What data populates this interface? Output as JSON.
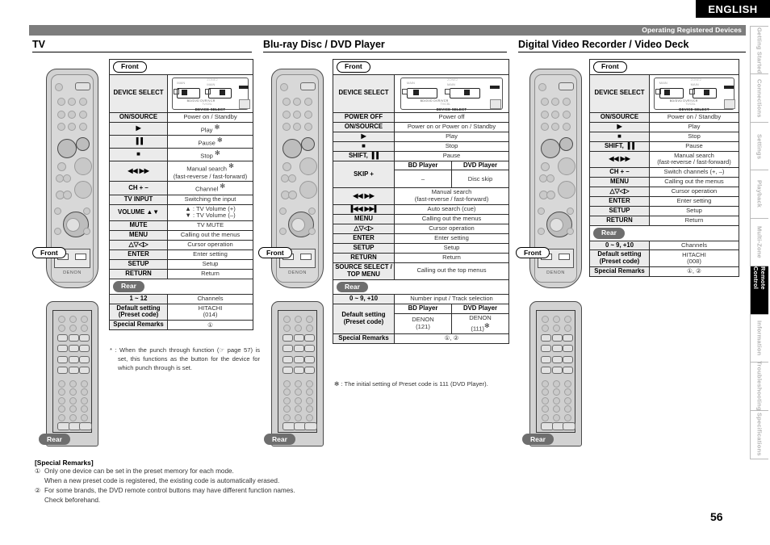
{
  "header": {
    "language_tab": "ENGLISH",
    "section_label": "Operating Registered Devices"
  },
  "page_number": "56",
  "sidebar": {
    "tabs": [
      {
        "label": "Getting Started",
        "active": false
      },
      {
        "label": "Connections",
        "active": false
      },
      {
        "label": "Settings",
        "active": false
      },
      {
        "label": "Playback",
        "active": false
      },
      {
        "label": "Multi-Zone",
        "active": false
      },
      {
        "label": "Remote Control",
        "active": true
      },
      {
        "label": "Information",
        "active": false
      },
      {
        "label": "Troubleshooting",
        "active": false
      },
      {
        "label": "Specifications",
        "active": false
      }
    ]
  },
  "columns": {
    "tv": {
      "title": "TV",
      "front_badge": "Front",
      "rear_badge": "Rear",
      "remote_front_badge": "Front",
      "remote_rear_badge": "Rear",
      "device_select_label": "DEVICE SELECT",
      "device_select_caption": "DEVICE SELECT",
      "rows": [
        {
          "key": "ON/SOURCE",
          "val": "Power on / Standby"
        },
        {
          "key": "▶",
          "val": "Play",
          "star": true
        },
        {
          "key": "▐▐",
          "val": "Pause",
          "star": true
        },
        {
          "key": "■",
          "val": "Stop",
          "star": true
        },
        {
          "key": "◀◀  ▶▶",
          "val": "Manual search",
          "val2": "(fast-reverse / fast-forward)",
          "star": true
        },
        {
          "key": "CH + –",
          "val": "Channel",
          "star": true
        },
        {
          "key": "TV INPUT",
          "val": "Switching the input"
        },
        {
          "key": "VOLUME ▲▼",
          "val": "▲ : TV Volume (+)",
          "val2": "▼ : TV Volume (–)"
        },
        {
          "key": "MUTE",
          "val": "TV MUTE"
        },
        {
          "key": "MENU",
          "val": "Calling out the menus"
        },
        {
          "key": "△▽◁▷",
          "val": "Cursor operation"
        },
        {
          "key": "ENTER",
          "val": "Enter setting"
        },
        {
          "key": "SETUP",
          "val": "Setup"
        },
        {
          "key": "RETURN",
          "val": "Return"
        }
      ],
      "rear_rows": [
        {
          "key": "1 ~ 12",
          "val": "Channels"
        },
        {
          "key": "Default setting",
          "key2": "(Preset code)",
          "val": "HITACHI",
          "val2": "(014)"
        },
        {
          "key": "Special Remarks",
          "val": "①"
        }
      ],
      "footnote": "* : When the punch through function (☞ page 57) is set, this functions as the button for the device for which punch through is set."
    },
    "bd": {
      "title": "Blu-ray Disc / DVD Player",
      "front_badge": "Front",
      "rear_badge": "Rear",
      "remote_front_badge": "Front",
      "remote_rear_badge": "Rear",
      "device_select_label": "DEVICE SELECT",
      "device_select_caption": "DEVICE SELECT",
      "rows": [
        {
          "key": "POWER OFF",
          "val": "Power off"
        },
        {
          "key": "ON/SOURCE",
          "val": "Power on or Power on / Standby"
        },
        {
          "key": "▶",
          "val": "Play"
        },
        {
          "key": "■",
          "val": "Stop"
        },
        {
          "key": "SHIFT, ▐▐",
          "val": "Pause"
        }
      ],
      "skip_block": {
        "col1_header": "BD Player",
        "col2_header": "DVD Player",
        "key": "SKIP +",
        "col1_val": "–",
        "col2_val": "Disc skip"
      },
      "rows2": [
        {
          "key": "◀◀  ▶▶",
          "val": "Manual search",
          "val2": "(fast-reverse / fast-forward)"
        },
        {
          "key": "▐◀◀  ▶▶▌",
          "val": "Auto search (cue)"
        },
        {
          "key": "MENU",
          "val": "Calling out the menus"
        },
        {
          "key": "△▽◁▷",
          "val": "Cursor operation"
        },
        {
          "key": "ENTER",
          "val": "Enter setting"
        },
        {
          "key": "SETUP",
          "val": "Setup"
        },
        {
          "key": "RETURN",
          "val": "Return"
        },
        {
          "key": "SOURCE SELECT /",
          "key2": "TOP MENU",
          "val": "Calling out the top menus"
        }
      ],
      "rear_rows": [
        {
          "key": "0 ~ 9, +10",
          "val": "Number input / Track selection"
        }
      ],
      "default_block": {
        "col1_header": "BD Player",
        "col2_header": "DVD Player",
        "key": "Default setting",
        "key2": "(Preset code)",
        "col1_val": "DENON",
        "col1_val2": "(121)",
        "col2_val": "DENON",
        "col2_val2": "(111)",
        "col2_star": true
      },
      "special_remarks": {
        "key": "Special Remarks",
        "val": "①, ②"
      },
      "footnote": "✻ : The initial setting of Preset code is 111 (DVD Player)."
    },
    "dvr": {
      "title": "Digital Video Recorder / Video Deck",
      "front_badge": "Front",
      "rear_badge": "Rear",
      "remote_front_badge": "Front",
      "remote_rear_badge": "Rear",
      "device_select_label": "DEVICE SELECT",
      "device_select_caption": "DEVICE SELECT",
      "rows": [
        {
          "key": "ON/SOURCE",
          "val": "Power on / Standby"
        },
        {
          "key": "▶",
          "val": "Play"
        },
        {
          "key": "■",
          "val": "Stop"
        },
        {
          "key": "SHIFT, ▐▐",
          "val": "Pause"
        },
        {
          "key": "◀◀  ▶▶",
          "val": "Manual search",
          "val2": "(fast-reverse / fast-forward)"
        },
        {
          "key": "CH + –",
          "val": "Switch channels (+, –)"
        },
        {
          "key": "MENU",
          "val": "Calling out the menus"
        },
        {
          "key": "△▽◁▷",
          "val": "Cursor operation"
        },
        {
          "key": "ENTER",
          "val": "Enter setting"
        },
        {
          "key": "SETUP",
          "val": "Setup"
        },
        {
          "key": "RETURN",
          "val": "Return"
        }
      ],
      "rear_rows": [
        {
          "key": "0 ~ 9, +10",
          "val": "Channels"
        },
        {
          "key": "Default setting",
          "key2": "(Preset code)",
          "val": "HITACHI",
          "val2": "(008)"
        },
        {
          "key": "Special Remarks",
          "val": "①, ②"
        }
      ]
    }
  },
  "special_remarks": {
    "title": "[Special Remarks]",
    "items": [
      {
        "num": "①",
        "line1": "Only one device can be set in the preset memory for each mode.",
        "line2": "When a new preset code is registered, the existing code is automatically erased."
      },
      {
        "num": "②",
        "line1": "For some brands, the DVD remote control buttons may have different function names.",
        "line2": "Check beforehand."
      }
    ]
  },
  "remote_graphics": {
    "brand": "DENON",
    "device_select_caption": "DEVICE SELECT",
    "zone_main": "MAIN",
    "zone_2": "ZONE2"
  }
}
